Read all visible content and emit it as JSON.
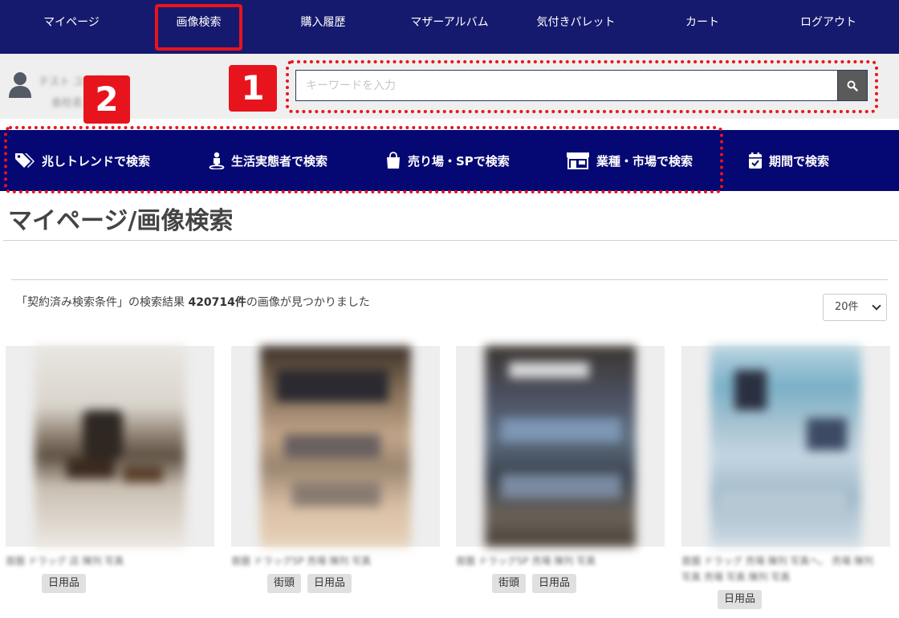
{
  "nav": {
    "items": [
      {
        "label": "マイページ"
      },
      {
        "label": "画像検索"
      },
      {
        "label": "購入履歴"
      },
      {
        "label": "マザーアルバム"
      },
      {
        "label": "気付きパレット"
      },
      {
        "label": "カート"
      },
      {
        "label": "ログアウト"
      }
    ],
    "active": "画像検索"
  },
  "user": {
    "name": "テスト ユーザー",
    "sub": "会社名"
  },
  "search": {
    "placeholder": "キーワードを入力",
    "value": ""
  },
  "badges": {
    "one": "1",
    "two": "2"
  },
  "categories": [
    {
      "label": "兆しトレンドで検索",
      "icon": "tag-icon"
    },
    {
      "label": "生活実態者で検索",
      "icon": "person-icon"
    },
    {
      "label": "売り場・SPで検索",
      "icon": "shopping-bag-icon"
    },
    {
      "label": "業種・市場で検索",
      "icon": "store-icon"
    },
    {
      "label": "期間で検索",
      "icon": "calendar-icon"
    }
  ],
  "page": {
    "title": "マイページ/画像検索"
  },
  "results": {
    "prefix": "「契約済み検索条件」の検索結果 ",
    "count": "420714件",
    "suffix": "の画像が見つかりました",
    "per_page": "20件"
  },
  "cards": [
    {
      "caption": "首圏 ドラッグ 店 陳列 写真",
      "tags": [
        "日用品"
      ]
    },
    {
      "caption": "首圏 ドラッグSP 売場 陳列 写真",
      "tags": [
        "街頭",
        "日用品"
      ]
    },
    {
      "caption": "首圏 ドラッグSP 売場 陳列 写真",
      "tags": [
        "街頭",
        "日用品"
      ]
    },
    {
      "caption": "首圏 ドラッグ 売場 陳列 写真へ。 売場 陳列 写真 売場 写真 陳列 写真",
      "tags": [
        "日用品"
      ]
    }
  ],
  "colors": {
    "nav_bg": "#161a6e",
    "cat_bg": "#050873",
    "highlight": "#e8141d"
  }
}
